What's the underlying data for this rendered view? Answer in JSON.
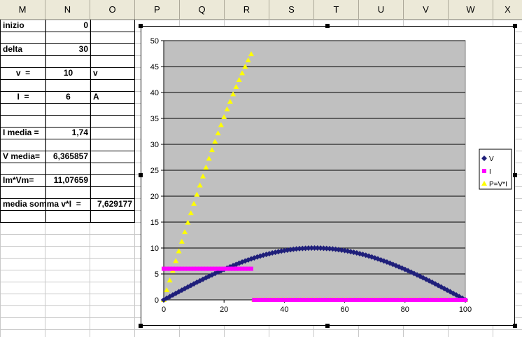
{
  "columns": [
    "M",
    "N",
    "O",
    "P",
    "Q",
    "R",
    "S",
    "T",
    "U",
    "V",
    "W",
    "X"
  ],
  "cells": {
    "inizio_label": "inizio",
    "inizio_value": "0",
    "delta_label": "delta",
    "delta_value": "30",
    "v_label": "v  =",
    "v_value": "10",
    "v_unit": "v",
    "i_label": "I  =",
    "i_value": "6",
    "i_unit": "A",
    "imedia_label": "I media =",
    "imedia_value": "1,74",
    "vmedia_label": "V media=",
    "vmedia_value": "6,365857",
    "imvm_label": "Im*Vm=",
    "imvm_value": "11,07659",
    "mediasomma_label": "media somma v*I  =",
    "mediasomma_value": "7,629177"
  },
  "colors": {
    "V": "#1f1f7a",
    "I": "#ff00ff",
    "P": "#ffff00",
    "plot_bg": "#c0c0c0"
  },
  "chart_data": {
    "type": "scatter",
    "x": {
      "min": 0,
      "max": 100,
      "ticks": [
        0,
        20,
        40,
        60,
        80,
        100
      ]
    },
    "y": {
      "min": 0,
      "max": 50,
      "ticks": [
        0,
        5,
        10,
        15,
        20,
        25,
        30,
        35,
        40,
        45,
        50
      ]
    },
    "grid": true,
    "legend_position": "right",
    "series": [
      {
        "name": "V",
        "marker": "diamond",
        "formula": "10*sin(pi*x/100)",
        "x_range": [
          0,
          100
        ],
        "step": 1
      },
      {
        "name": "I",
        "marker": "square",
        "segments": [
          {
            "x_range": [
              0,
              29
            ],
            "step": 1,
            "value": 6
          },
          {
            "x_range": [
              30,
              100
            ],
            "step": 1,
            "value": 0
          }
        ]
      },
      {
        "name": "P=V*I",
        "marker": "triangle",
        "segments": [
          {
            "x_range": [
              0,
              29
            ],
            "step": 1,
            "formula": "6*10*sin(pi*x/100)"
          },
          {
            "x_range": [
              30,
              100
            ],
            "step": 1,
            "value": 0
          }
        ]
      }
    ]
  }
}
